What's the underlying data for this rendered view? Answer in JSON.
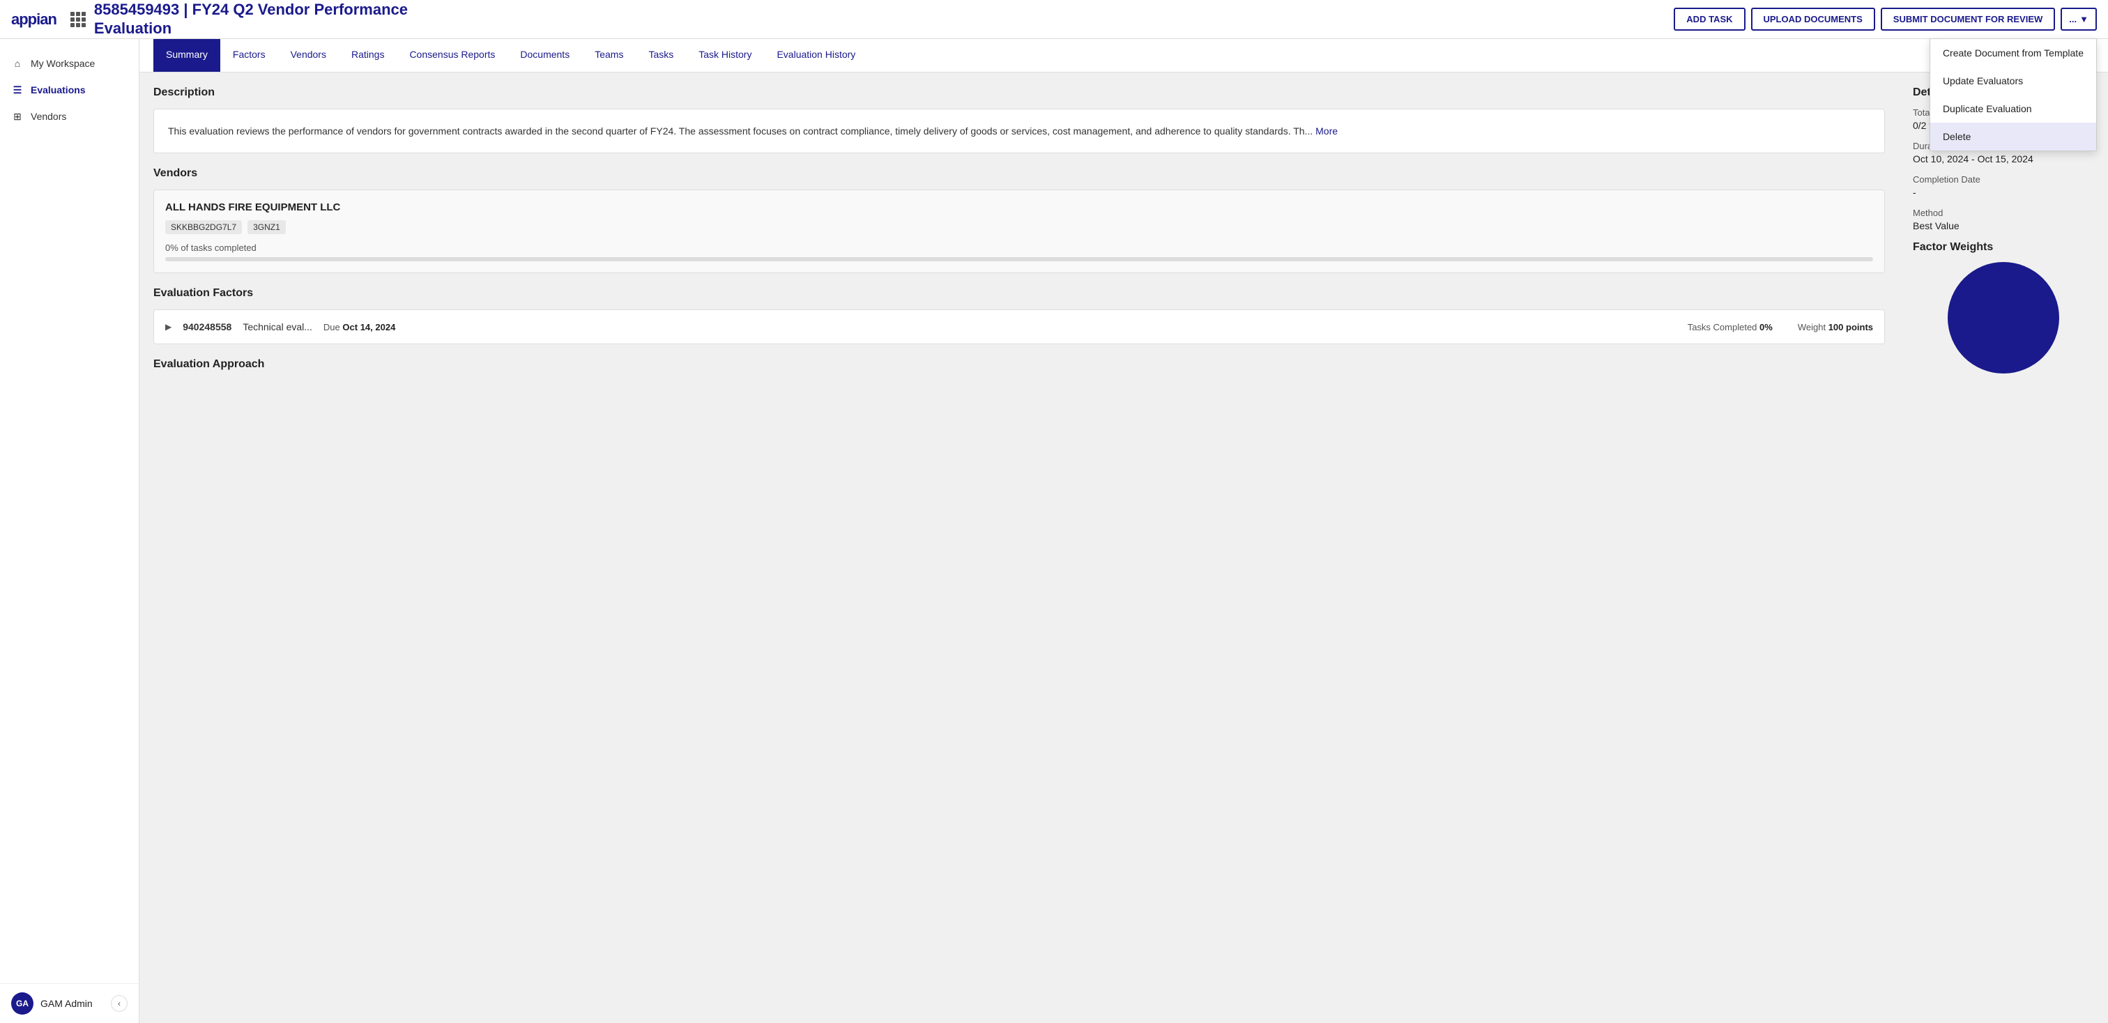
{
  "app": {
    "logo": "appian",
    "grid_label": "grid-menu"
  },
  "header": {
    "title_line1": "8585459493 | FY24 Q2 Vendor Performance",
    "title_line2": "Evaluation",
    "add_task_btn": "ADD TASK",
    "upload_docs_btn": "UPLOAD DOCUMENTS",
    "submit_review_btn": "SUBMIT DOCUMENT FOR REVIEW",
    "more_btn": "...",
    "more_chevron": "▼"
  },
  "dropdown": {
    "items": [
      {
        "label": "Create Document from Template",
        "active": false
      },
      {
        "label": "Update Evaluators",
        "active": false
      },
      {
        "label": "Duplicate Evaluation",
        "active": false
      },
      {
        "label": "Delete",
        "active": true
      }
    ]
  },
  "sidebar": {
    "items": [
      {
        "label": "My Workspace",
        "icon": "home",
        "active": false
      },
      {
        "label": "Evaluations",
        "icon": "list",
        "active": true
      },
      {
        "label": "Vendors",
        "icon": "grid",
        "active": false
      }
    ],
    "user": {
      "initials": "GA",
      "name": "GAM Admin"
    },
    "collapse_arrow": "‹"
  },
  "tabs": [
    {
      "label": "Summary",
      "active": true
    },
    {
      "label": "Factors",
      "active": false
    },
    {
      "label": "Vendors",
      "active": false
    },
    {
      "label": "Ratings",
      "active": false
    },
    {
      "label": "Consensus Reports",
      "active": false
    },
    {
      "label": "Documents",
      "active": false
    },
    {
      "label": "Teams",
      "active": false
    },
    {
      "label": "Tasks",
      "active": false
    },
    {
      "label": "Task History",
      "active": false
    },
    {
      "label": "Evaluation History",
      "active": false
    }
  ],
  "main": {
    "description_title": "Description",
    "description_text": "This evaluation reviews the performance of vendors for government contracts awarded in the second quarter of FY24. The assessment focuses on contract compliance, timely delivery of goods or services, cost management, and adherence to quality standards. Th...",
    "more_link": "More",
    "vendors_title": "Vendors",
    "vendor": {
      "name": "ALL HANDS FIRE EQUIPMENT LLC",
      "tags": [
        "SKKBBG2DG7L7",
        "3GNZ1"
      ],
      "progress_label": "0% of tasks completed",
      "progress_pct": 0
    },
    "factors_title": "Evaluation Factors",
    "factor": {
      "id": "940248558",
      "desc": "Technical eval...",
      "due_label": "Due",
      "due_date": "Oct 14, 2024",
      "tasks_label": "Tasks Completed",
      "tasks_pct": "0%",
      "weight_label": "Weight",
      "weight_val": "100 points"
    },
    "approach_title": "Evaluation Approach"
  },
  "details": {
    "panel_title": "Details",
    "total_tasks_label": "Total Tasks Completed",
    "total_tasks_value": "0/2 tasks",
    "duration_label": "Duration",
    "duration_value": "Oct 10, 2024 - Oct 15, 2024",
    "completion_label": "Completion Date",
    "completion_value": "-",
    "method_label": "Method",
    "method_value": "Best Value",
    "factor_weights_title": "Factor Weights"
  }
}
